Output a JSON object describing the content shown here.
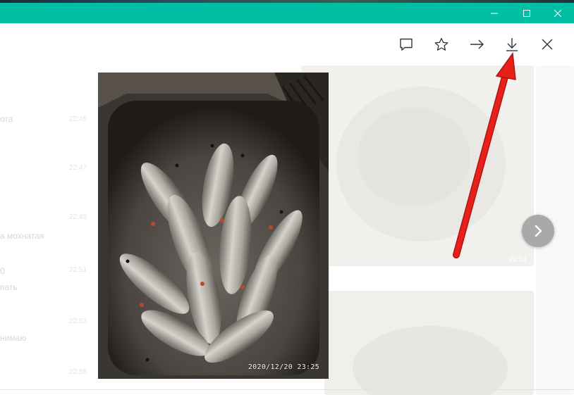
{
  "window": {
    "accent_color": "#00bfa5",
    "controls": [
      "minimize-icon",
      "maximize-icon",
      "close-icon"
    ]
  },
  "toolbar": {
    "icons": [
      "comment-icon",
      "star-icon",
      "forward-icon",
      "download-icon",
      "close-icon"
    ]
  },
  "photo": {
    "timestamp": "2020/12/20  23:25",
    "subject": "fish in metal sink"
  },
  "background_chat": {
    "snippets": [
      "ота",
      "а мохнатая",
      "0",
      "пать",
      "нимаю"
    ],
    "times": [
      "22:45",
      "22:47",
      "22:49",
      "22:51",
      "22:53",
      "22:58"
    ],
    "photo_time": "22:51"
  },
  "annotation": {
    "color": "#e8201c",
    "points_to": "download-icon"
  }
}
